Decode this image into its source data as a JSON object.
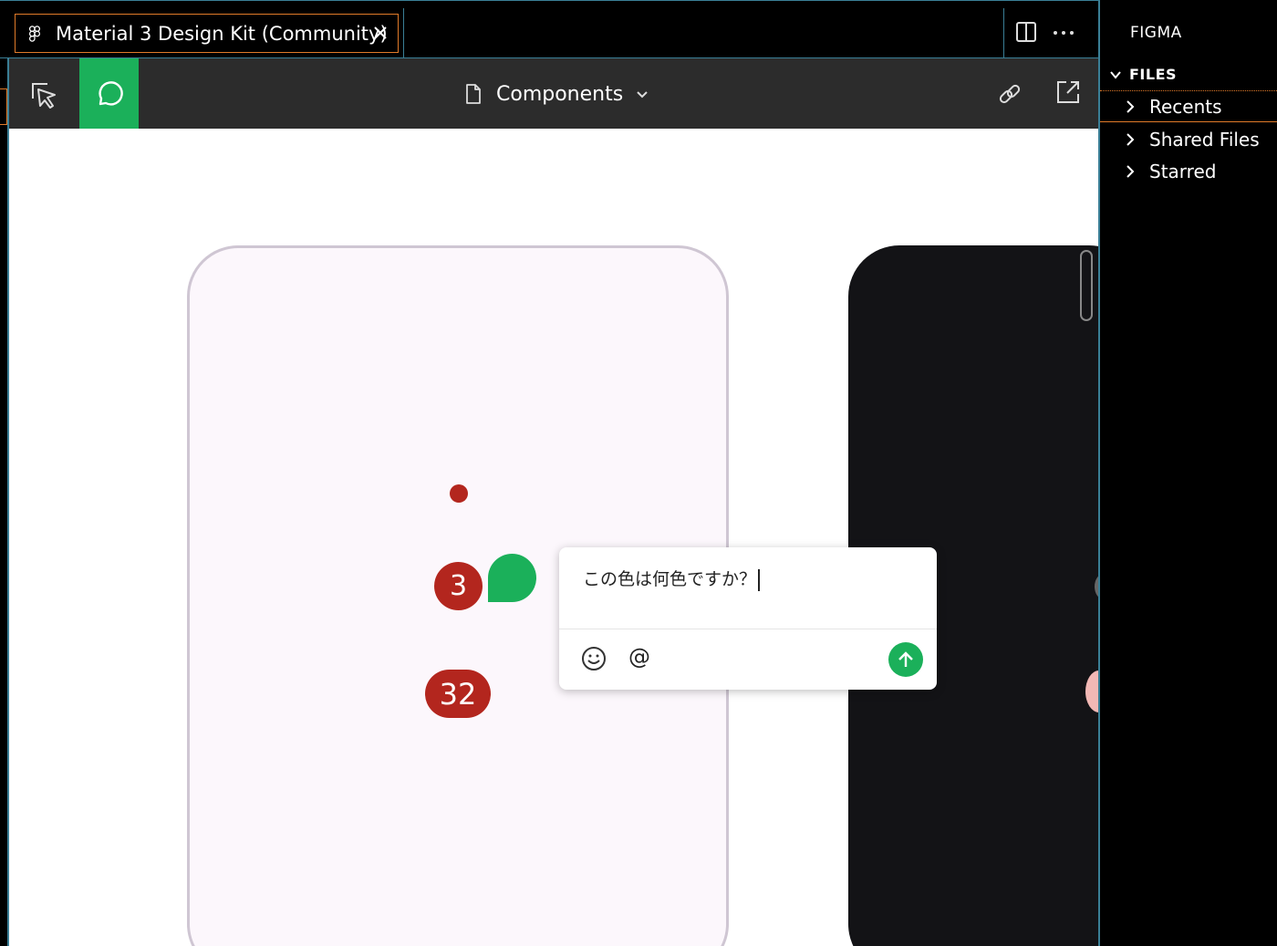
{
  "tab": {
    "title": "Material 3 Design Kit (Community)"
  },
  "toolbar": {
    "page_label": "Components"
  },
  "canvas": {
    "badges": {
      "small": "3",
      "large": "32"
    },
    "comment": {
      "text": "この色は何色ですか？",
      "mention_symbol": "@"
    }
  },
  "sidebar": {
    "title": "FIGMA",
    "section": "FILES",
    "items": [
      {
        "label": "Recents"
      },
      {
        "label": "Shared Files"
      },
      {
        "label": "Starred"
      }
    ]
  },
  "colors": {
    "accent_green": "#1bb05a",
    "badge_red": "#b3261e",
    "focus_orange": "#e07a29",
    "border_teal": "#3a7f96"
  },
  "icons": [
    "figma-icon",
    "close-icon",
    "split-view-icon",
    "more-icon",
    "move-tool-icon",
    "comment-icon",
    "page-icon",
    "chevron-down-icon",
    "link-icon",
    "open-external-icon",
    "emoji-icon",
    "send-icon",
    "chevron-right-icon"
  ]
}
